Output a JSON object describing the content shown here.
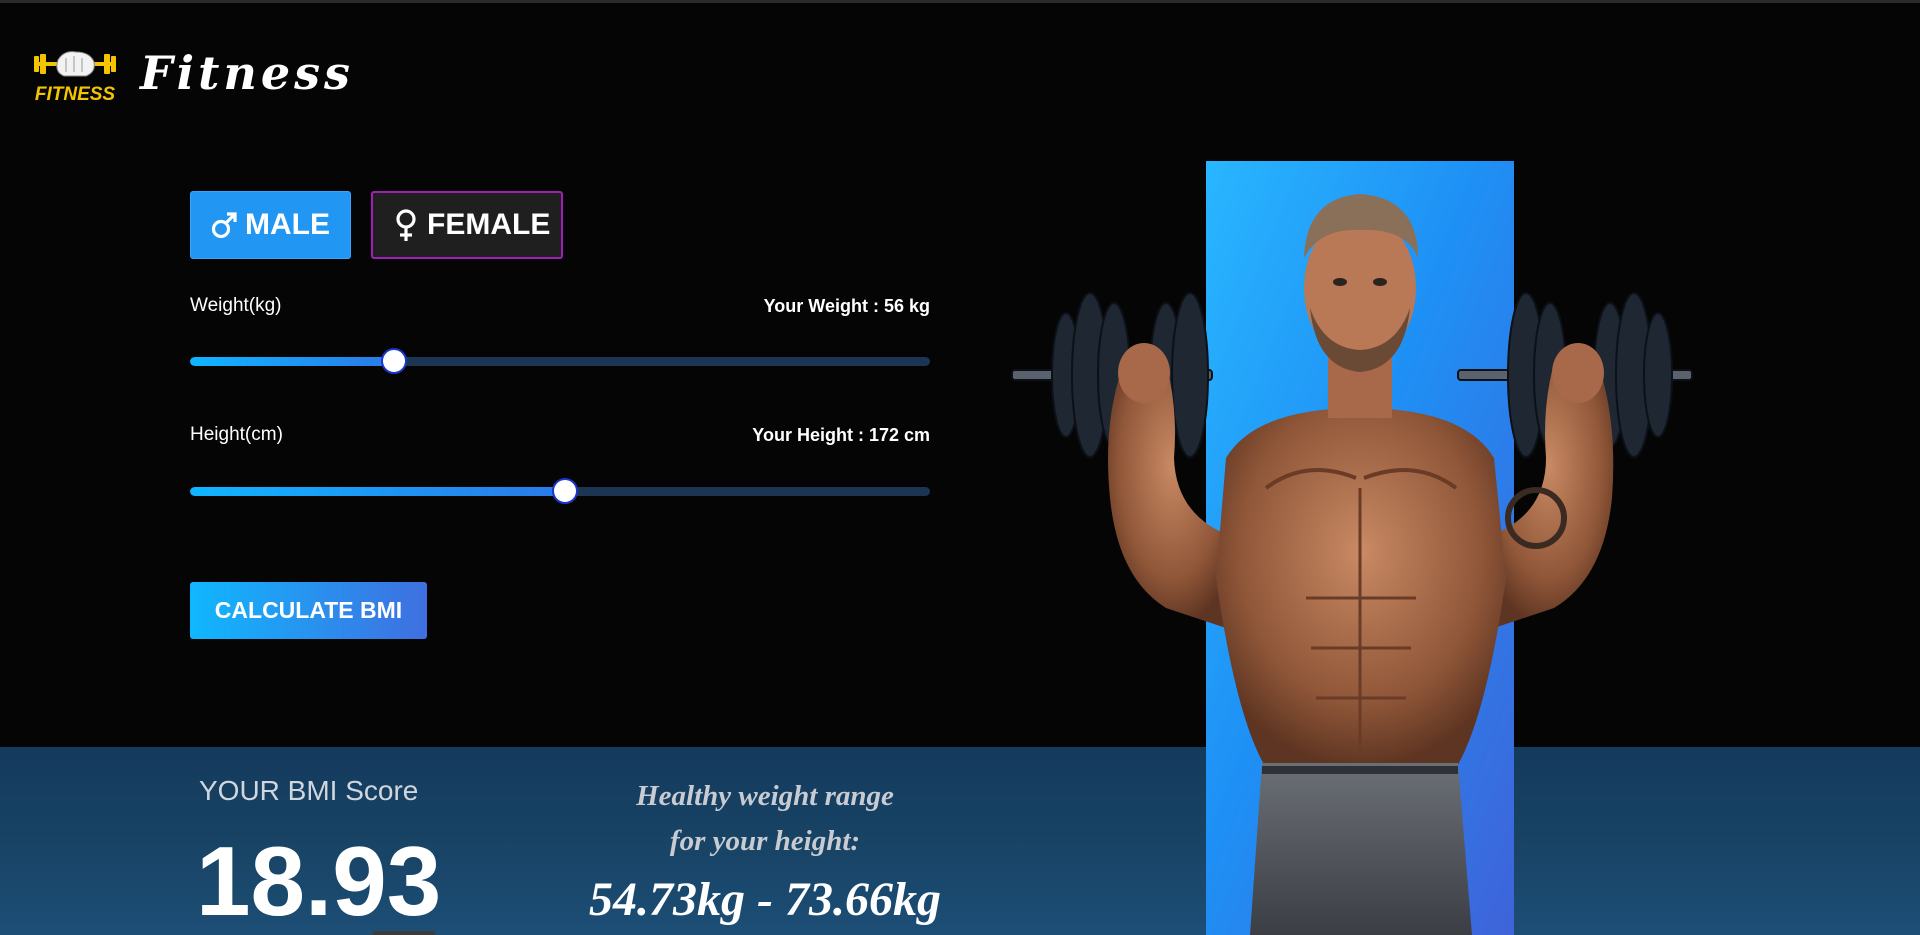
{
  "header": {
    "logo_text": "FITNESS",
    "title": "Fitness"
  },
  "gender": {
    "options": [
      {
        "label": "MALE",
        "icon": "male-symbol-icon",
        "selected": true
      },
      {
        "label": "FEMALE",
        "icon": "female-symbol-icon",
        "selected": false
      }
    ]
  },
  "weight": {
    "label": "Weight(kg)",
    "value_text": "Your Weight : 56 kg",
    "slider_fraction": 0.276
  },
  "height": {
    "label": "Height(cm)",
    "value_text": "Your Height : 172 cm",
    "slider_fraction": 0.507
  },
  "calculate": {
    "label": "CALCULATE BMI"
  },
  "result": {
    "score_label": "YOUR BMI Score",
    "score": "18.93",
    "healthy_label_line1": "Healthy weight range",
    "healthy_label_line2": "for your height:",
    "healthy_range": "54.73kg - 73.66kg"
  },
  "colors": {
    "accent_blue": "#2196f3",
    "female_border": "#a01fb8",
    "background": "#050505",
    "logo_yellow": "#f5c400"
  },
  "hero": {
    "icon": "athlete-with-dumbbells-photo"
  }
}
